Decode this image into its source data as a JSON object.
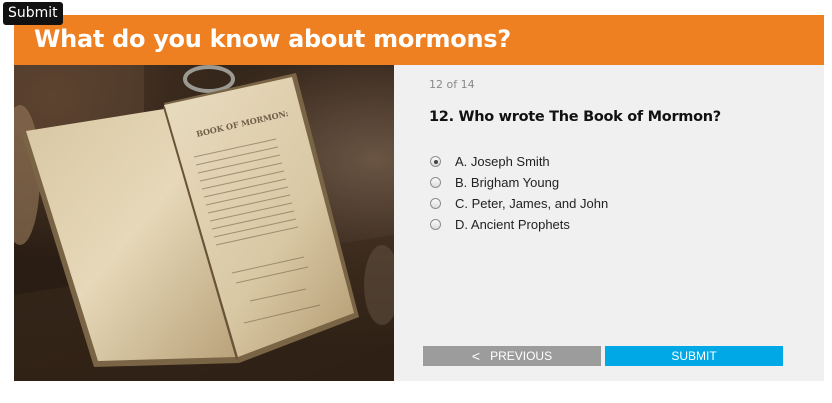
{
  "tooltip": {
    "text": "Submit"
  },
  "header": {
    "title": "What do you know about mormons?"
  },
  "colors": {
    "header": "#ef8022",
    "submit": "#00a9e6",
    "previous": "#9c9c9c",
    "panel": "#f0f0f0"
  },
  "image": {
    "subject": "open antique Book of Mormon on wooden table",
    "title_page": "BOOK OF MORMON:"
  },
  "quiz": {
    "progress": "12 of 14",
    "question": "12. Who wrote The Book of Mormon?",
    "options": [
      {
        "label": "A. Joseph Smith",
        "selected": true
      },
      {
        "label": "B. Brigham Young",
        "selected": false
      },
      {
        "label": "C. Peter, James, and John",
        "selected": false
      },
      {
        "label": "D. Ancient Prophets",
        "selected": false
      }
    ]
  },
  "buttons": {
    "previous": "PREVIOUS",
    "previous_icon": "chevron-left-icon",
    "submit": "SUBMIT"
  }
}
